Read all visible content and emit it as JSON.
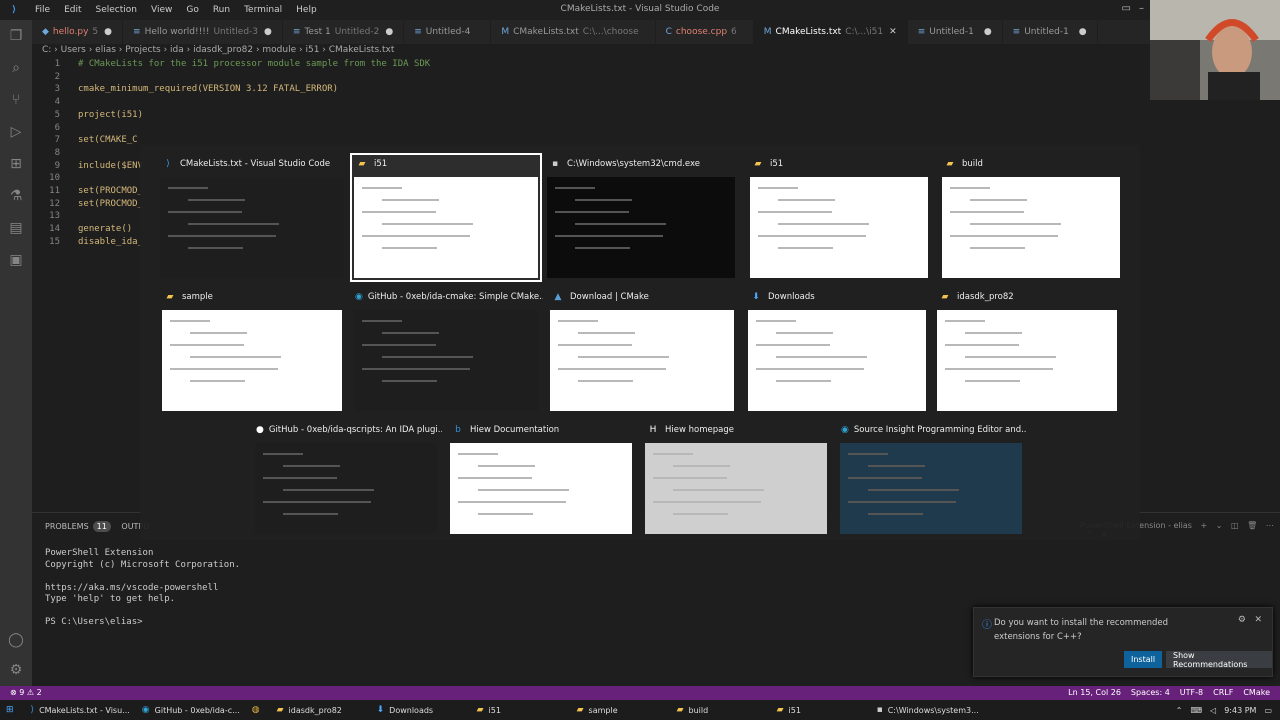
{
  "window": {
    "title": "CMakeLists.txt - Visual Studio Code"
  },
  "menu": [
    "File",
    "Edit",
    "Selection",
    "View",
    "Go",
    "Run",
    "Terminal",
    "Help"
  ],
  "tabs": [
    {
      "label": "hello.py",
      "desc": "5",
      "modified": true,
      "red": true
    },
    {
      "label": "Hello world!!!!",
      "desc": "Untitled-3",
      "modified": true
    },
    {
      "label": "Test 1",
      "desc": "Untitled-2",
      "modified": true
    },
    {
      "label": "Untitled-4",
      "desc": "",
      "modified": false
    },
    {
      "label": "CMakeLists.txt",
      "desc": "C:\\...\\choose",
      "modified": false
    },
    {
      "label": "choose.cpp",
      "desc": "6",
      "modified": false,
      "red": true
    },
    {
      "label": "CMakeLists.txt",
      "desc": "C:\\...\\i51",
      "modified": false,
      "active": true
    },
    {
      "label": "Untitled-1",
      "desc": "",
      "modified": true
    },
    {
      "label": "Untitled-1",
      "desc": "",
      "modified": true
    }
  ],
  "breadcrumb": "C: › Users › elias › Projects › ida › idasdk_pro82 › module › i51 › CMakeLists.txt",
  "editor": {
    "lines": [
      {
        "n": "1",
        "text": "# CMakeLists for the i51 processor module sample from the IDA SDK",
        "comment": true
      },
      {
        "n": "2",
        "text": ""
      },
      {
        "n": "3",
        "text": "cmake_minimum_required(VERSION 3.12 FATAL_ERROR)"
      },
      {
        "n": "4",
        "text": ""
      },
      {
        "n": "5",
        "text": "project(i51)"
      },
      {
        "n": "6",
        "text": ""
      },
      {
        "n": "7",
        "text": "set(CMAKE_C"
      },
      {
        "n": "8",
        "text": ""
      },
      {
        "n": "9",
        "text": "include($ENV"
      },
      {
        "n": "10",
        "text": ""
      },
      {
        "n": "11",
        "text": "set(PROCMOD_"
      },
      {
        "n": "12",
        "text": "set(PROCMOD_"
      },
      {
        "n": "13",
        "text": ""
      },
      {
        "n": "14",
        "text": "generate()"
      },
      {
        "n": "15",
        "text": "disable_ida_"
      }
    ]
  },
  "switcher": {
    "items": [
      {
        "title": "CMakeLists.txt - Visual Studio Code",
        "icon": "vscode-icon",
        "style": "dark"
      },
      {
        "title": "i51",
        "icon": "folder-icon",
        "style": "light",
        "selected": true
      },
      {
        "title": "C:\\Windows\\system32\\cmd.exe",
        "icon": "cmd-icon",
        "style": "black"
      },
      {
        "title": "i51",
        "icon": "folder-icon",
        "style": "light"
      },
      {
        "title": "build",
        "icon": "folder-icon",
        "style": "light"
      },
      {
        "title": "sample",
        "icon": "folder-icon",
        "style": "light"
      },
      {
        "title": "GitHub - 0xeb/ida-cmake: Simple CMake...",
        "icon": "edge-icon",
        "style": "dark"
      },
      {
        "title": "Download | CMake",
        "icon": "cmake-icon",
        "style": "light"
      },
      {
        "title": "Downloads",
        "icon": "download-folder-icon",
        "style": "light"
      },
      {
        "title": "idasdk_pro82",
        "icon": "folder-icon",
        "style": "light"
      },
      {
        "title": "GitHub - 0xeb/ida-qscripts: An IDA plugi...",
        "icon": "github-icon",
        "style": "dark"
      },
      {
        "title": "Hiew Documentation",
        "icon": "bing-icon",
        "style": "light"
      },
      {
        "title": "Hiew homepage",
        "icon": "hiew-icon",
        "style": "grey"
      },
      {
        "title": "Source Insight Programming Editor and...",
        "icon": "edge-icon",
        "style": "site"
      }
    ]
  },
  "panel": {
    "problems_label": "PROBLEMS",
    "problems_count": "11",
    "output_label": "OUTPU",
    "terminal_name": "PowerShell Extension - elias",
    "terminal_lines": [
      "PowerShell Extension",
      "Copyright (c) Microsoft Corporation.",
      "",
      "https://aka.ms/vscode-powershell",
      "Type 'help' to get help.",
      "",
      "PS C:\\Users\\elias>"
    ]
  },
  "notification": {
    "message": "Do you want to install the recommended extensions for C++?",
    "install": "Install",
    "show": "Show Recommendations"
  },
  "statusbar": {
    "left": "⊗ 9 ⚠ 2",
    "items": [
      "Ln 15, Col 26",
      "Spaces: 4",
      "UTF-8",
      "CRLF",
      "CMake"
    ]
  },
  "taskbar": {
    "items": [
      {
        "label": "CMakeLists.txt - Visu...",
        "icon": "vscode-icon"
      },
      {
        "label": "GitHub - 0xeb/ida-c...",
        "icon": "edge-icon"
      },
      {
        "label": "",
        "icon": "chrome-icon"
      },
      {
        "label": "idasdk_pro82",
        "icon": "folder-icon"
      },
      {
        "label": "Downloads",
        "icon": "download-folder-icon"
      },
      {
        "label": "i51",
        "icon": "folder-icon"
      },
      {
        "label": "sample",
        "icon": "folder-icon"
      },
      {
        "label": "build",
        "icon": "folder-icon"
      },
      {
        "label": "i51",
        "icon": "folder-icon"
      },
      {
        "label": "C:\\Windows\\system3...",
        "icon": "cmd-icon"
      }
    ],
    "time": "9:43 PM"
  },
  "colors": {
    "statusbar": "#68217a",
    "accent": "#0e639c"
  }
}
